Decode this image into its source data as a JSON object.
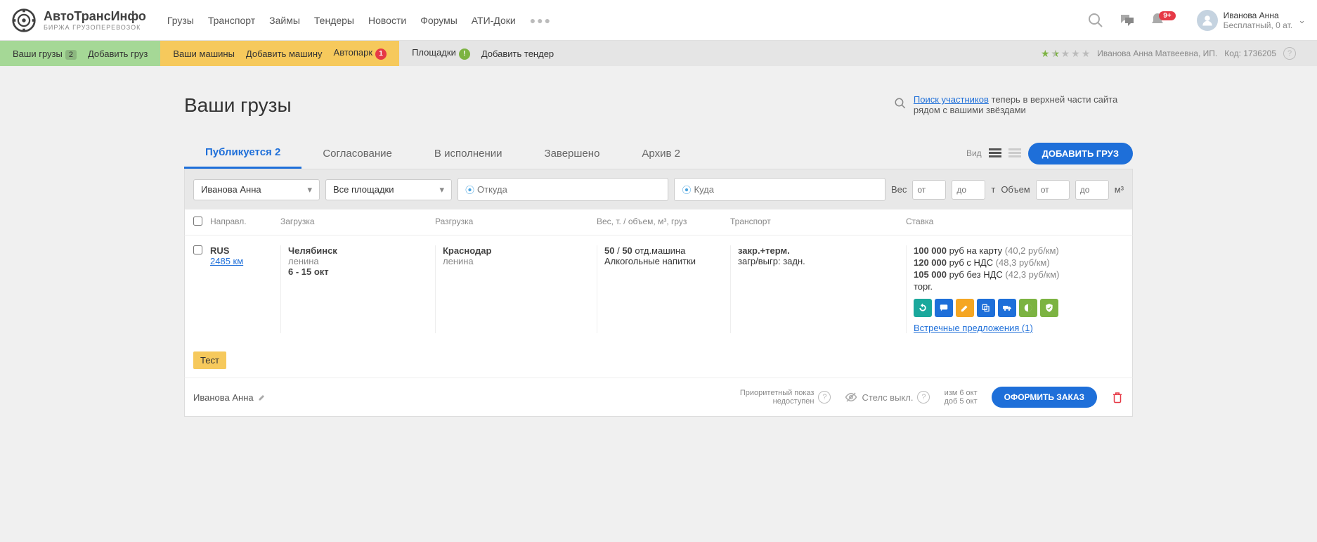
{
  "logo": {
    "title": "АвтоТрансИнфо",
    "subtitle": "БИРЖА ГРУЗОПЕРЕВОЗОК"
  },
  "nav": {
    "cargo": "Грузы",
    "transport": "Транспорт",
    "loans": "Займы",
    "tenders": "Тендеры",
    "news": "Новости",
    "forums": "Форумы",
    "docs": "АТИ-Доки"
  },
  "header": {
    "notif_count": "9+",
    "user_name": "Иванова Анна",
    "user_plan": "Бесплатный, 0 ат."
  },
  "subnav": {
    "your_cargo": "Ваши грузы",
    "your_cargo_count": "2",
    "add_cargo": "Добавить груз",
    "your_vehicles": "Ваши машины",
    "add_vehicle": "Добавить машину",
    "autopark": "Автопарк",
    "autopark_badge": "1",
    "sites": "Площадки",
    "sites_badge": "!",
    "add_tender": "Добавить тендер",
    "account_label": "Иванова Анна Матвеевна, ИП.",
    "code_label": "Код: 1736205"
  },
  "page": {
    "title": "Ваши грузы"
  },
  "notice": {
    "link": "Поиск участников",
    "text": " теперь в верхней части сайта рядом с вашими звёздами"
  },
  "tabs": {
    "publishing": "Публикуется 2",
    "agreement": "Согласование",
    "executing": "В исполнении",
    "done": "Завершено",
    "archive": "Архив 2",
    "view": "Вид",
    "add_btn": "ДОБАВИТЬ ГРУЗ"
  },
  "filters": {
    "user": "Иванова Анна",
    "sites": "Все площадки",
    "from_ph": "Откуда",
    "to_ph": "Куда",
    "weight": "Вес",
    "from": "от",
    "to": "до",
    "t": "т",
    "volume": "Объем",
    "m3": "м³"
  },
  "thead": {
    "dir": "Направл.",
    "load": "Загрузка",
    "unload": "Разгрузка",
    "weight": "Вес, т. / объем, м³, груз",
    "trans": "Транспорт",
    "rate": "Ставка"
  },
  "row": {
    "country": "RUS",
    "distance": "2485 км",
    "load_city": "Челябинск",
    "load_addr": "ленина",
    "load_dates": "6 - 15 окт",
    "unload_city": "Краснодар",
    "unload_addr": "ленина",
    "weight_a": "50",
    "slash": " / ",
    "weight_b": "50",
    "weight_suffix": " отд.машина",
    "cargo_type": "Алкогольные напитки",
    "trans_type": "закр.+терм.",
    "trans_detail": "загр/выгр: задн.",
    "r1a": "100 000",
    "r1b": " руб на карту ",
    "r1c": "(40,2 руб/км)",
    "r2a": "120 000",
    "r2b": " руб с НДС ",
    "r2c": "(48,3 руб/км)",
    "r3a": "105 000",
    "r3b": " руб без НДС ",
    "r3c": "(42,3 руб/км)",
    "neg": "торг.",
    "counter_link": "Встречные предложения (1)"
  },
  "tag": "Тест",
  "footer": {
    "owner": "Иванова Анна",
    "priority_l1": "Приоритетный показ",
    "priority_l2": "недоступен",
    "stealth": "Стелс выкл.",
    "mod_l1": "изм 6 окт",
    "mod_l2": "доб 5 окт",
    "order_btn": "ОФОРМИТЬ ЗАКАЗ"
  }
}
